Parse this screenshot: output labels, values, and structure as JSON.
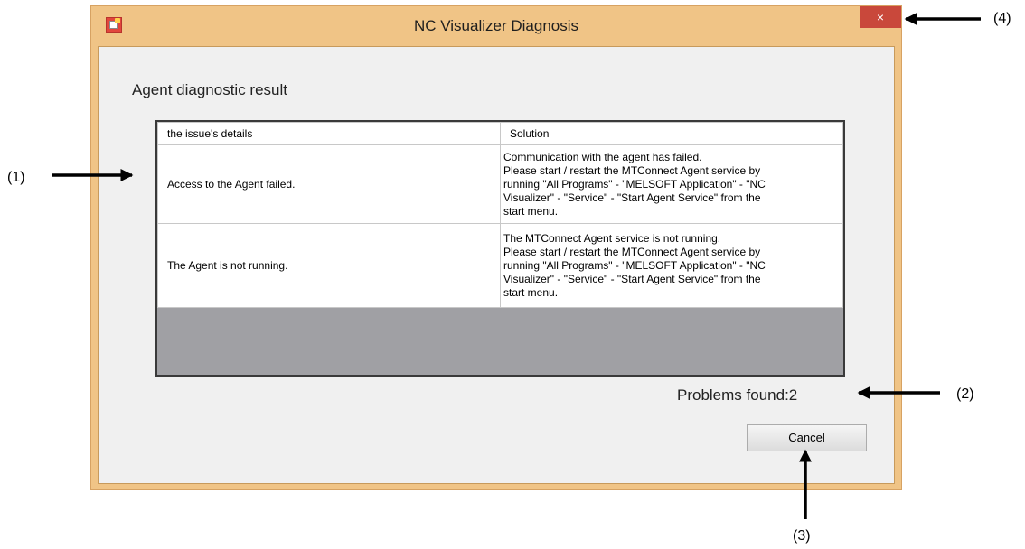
{
  "window": {
    "title": "NC Visualizer Diagnosis",
    "close_label": "×"
  },
  "main": {
    "heading": "Agent diagnostic result",
    "table": {
      "columns": [
        "the issue's details",
        "Solution"
      ],
      "rows": [
        {
          "issue": "Access to the Agent failed.",
          "solution": [
            "Communication with the agent has failed.",
            "Please start / restart the MTConnect Agent service by",
            "running \"All Programs\" - \"MELSOFT Application\" - \"NC",
            "Visualizer\" - \"Service\" - \"Start Agent Service\" from the",
            "start menu."
          ]
        },
        {
          "issue": "The Agent is not running.",
          "solution": [
            "The MTConnect Agent service is not running.",
            "Please start / restart the MTConnect Agent service by",
            "running \"All Programs\" - \"MELSOFT Application\" - \"NC",
            "Visualizer\" - \"Service\" - \"Start Agent Service\" from the",
            "start menu."
          ]
        }
      ]
    },
    "problems_found": "Problems found:2",
    "cancel_label": "Cancel"
  },
  "annotations": {
    "c1": "(1)",
    "c2": "(2)",
    "c3": "(3)",
    "c4": "(4)"
  },
  "colors": {
    "frame": "#f0c486",
    "close_button": "#c9483b",
    "client": "#f0f0f0",
    "grid_empty": "#a0a0a4"
  }
}
